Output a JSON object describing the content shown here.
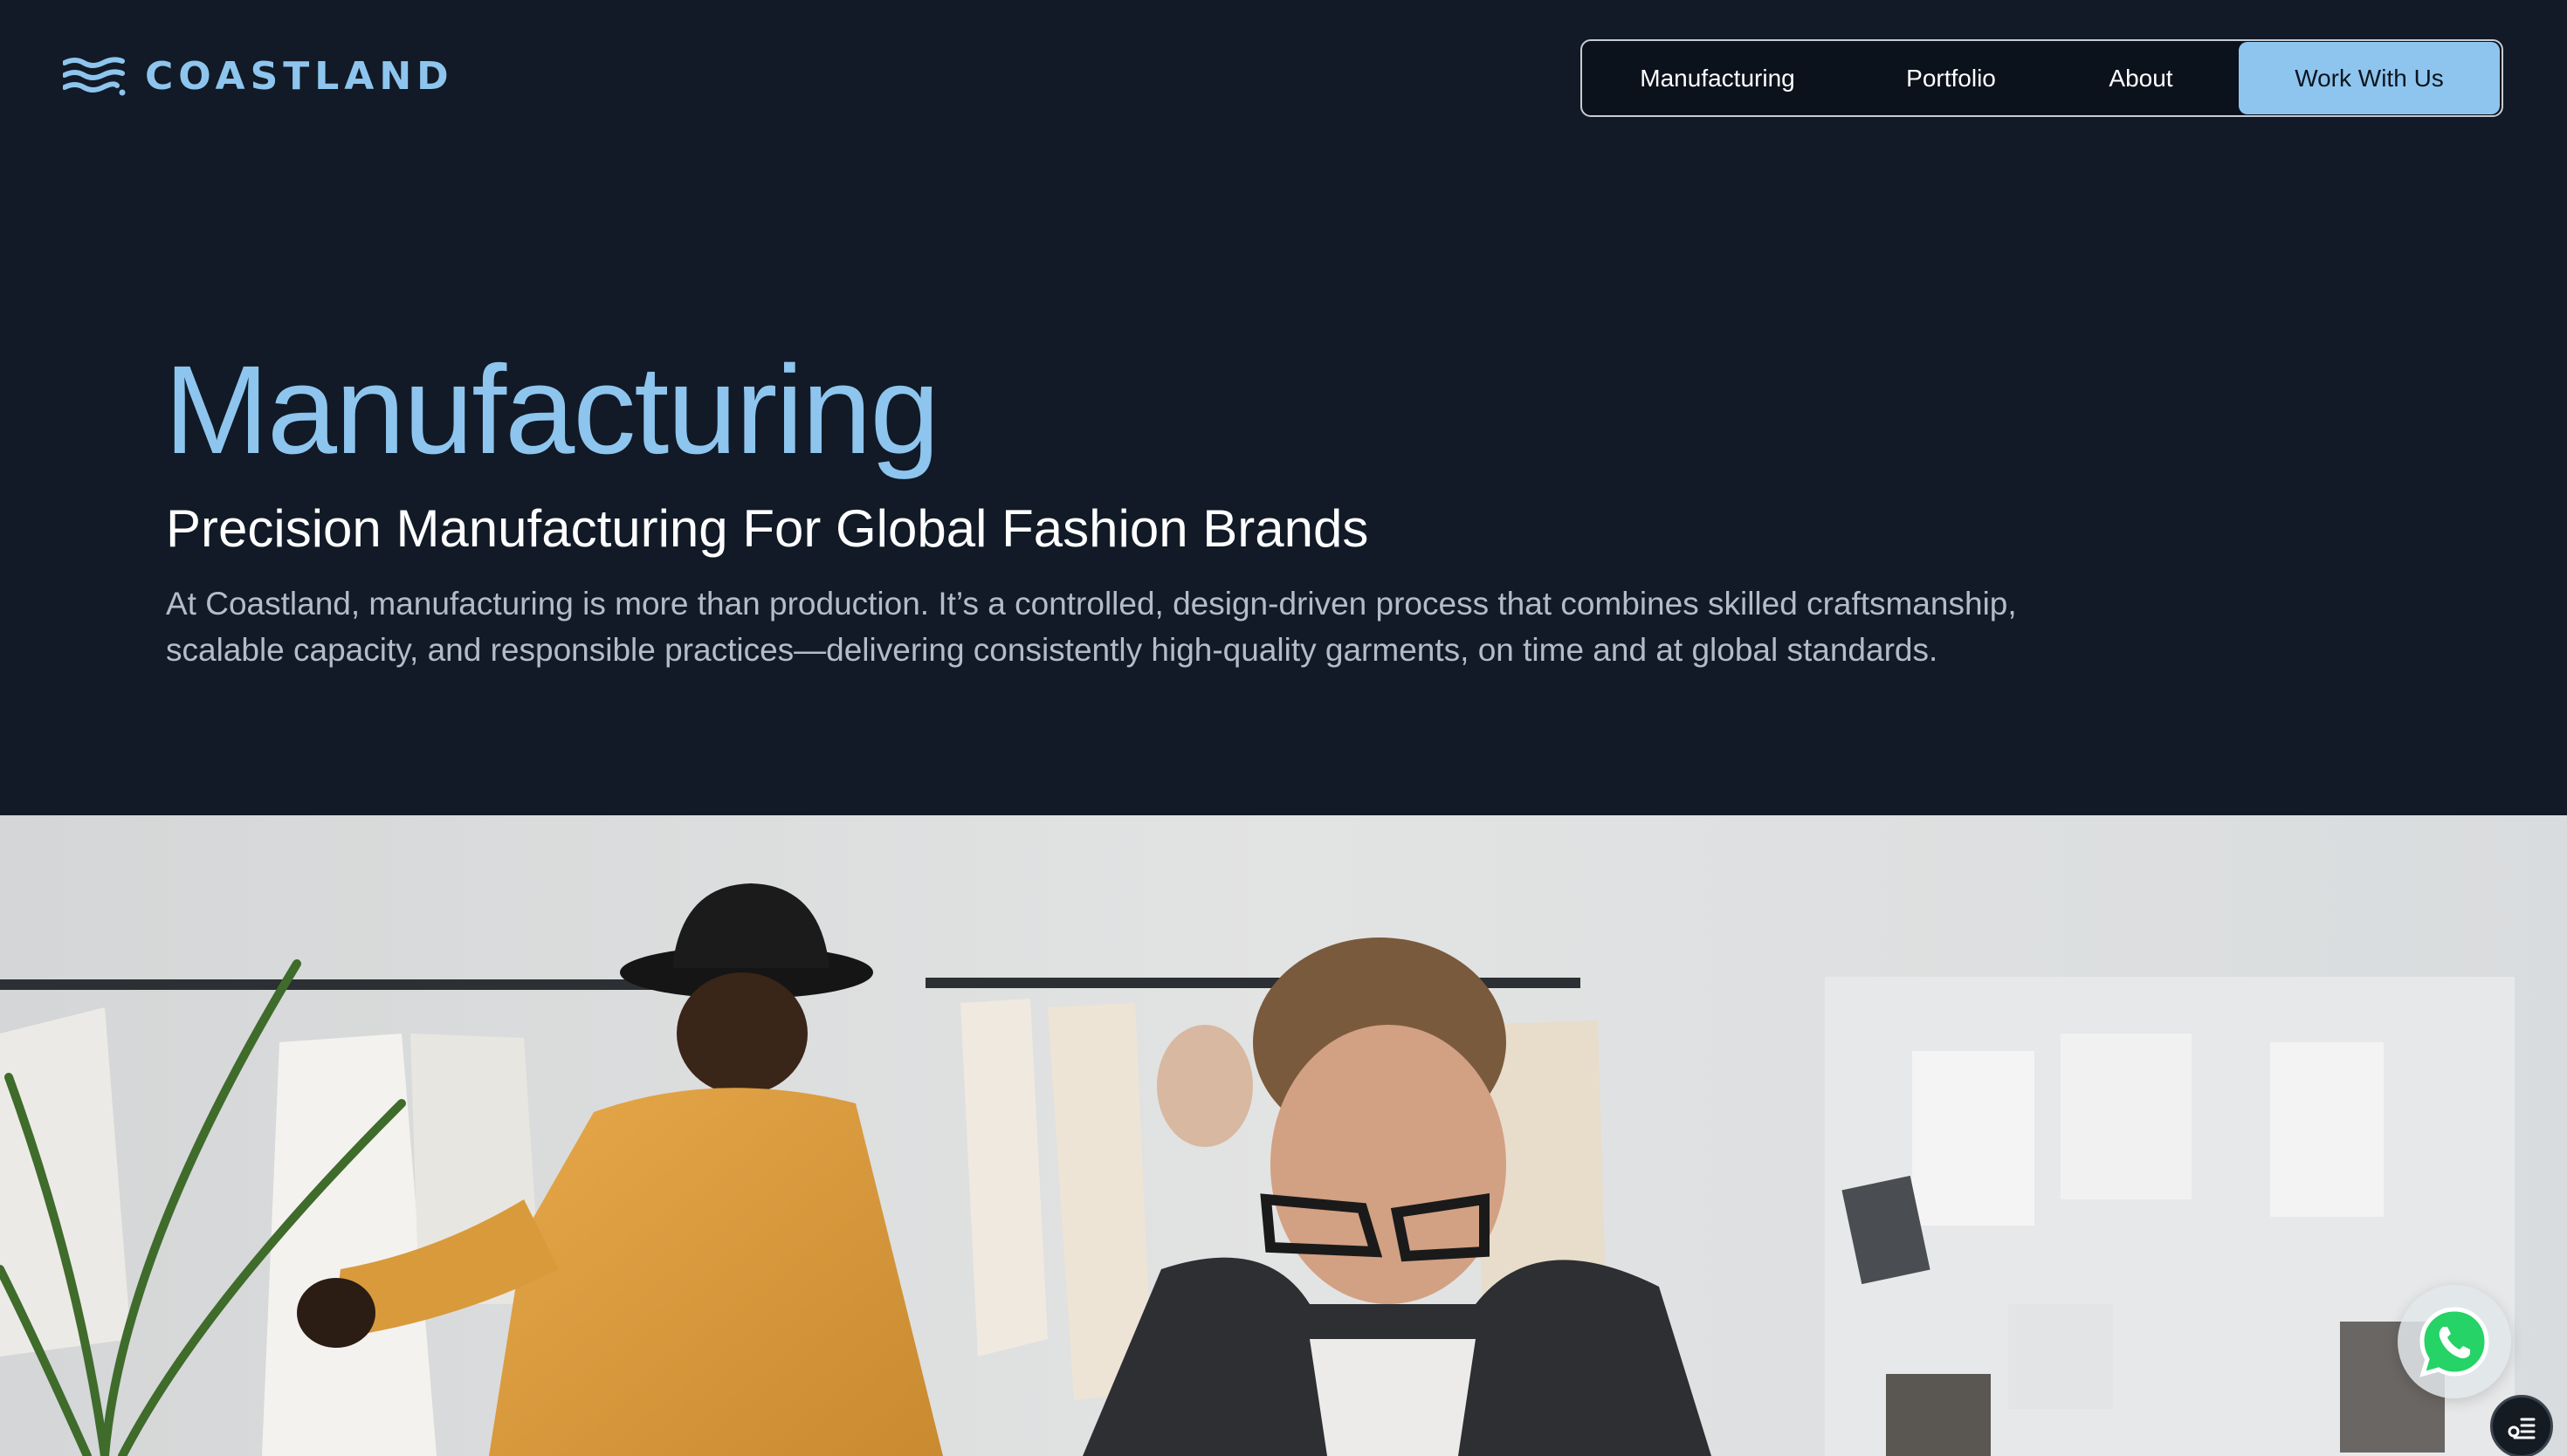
{
  "brand": {
    "name": "COASTLAND",
    "logo_icon": "waves-logo-icon",
    "accent_color": "#8ec5ee",
    "background_color": "#111a26"
  },
  "nav": {
    "items": [
      {
        "label": "Manufacturing"
      },
      {
        "label": "Portfolio"
      },
      {
        "label": "About"
      }
    ],
    "cta_label": "Work With Us"
  },
  "hero": {
    "title": "Manufacturing",
    "subtitle": "Precision Manufacturing For Global Fashion Brands",
    "description": "At Coastland, manufacturing is more than production. It’s a controlled, design-driven process that combines skilled craftsmanship, scalable capacity, and responsible practices—delivering consistently high-quality garments, on time and at global standards."
  },
  "floating": {
    "whatsapp_icon": "whatsapp-icon",
    "whatsapp_color": "#25d366",
    "helper_icon": "accessibility-menu-icon"
  }
}
